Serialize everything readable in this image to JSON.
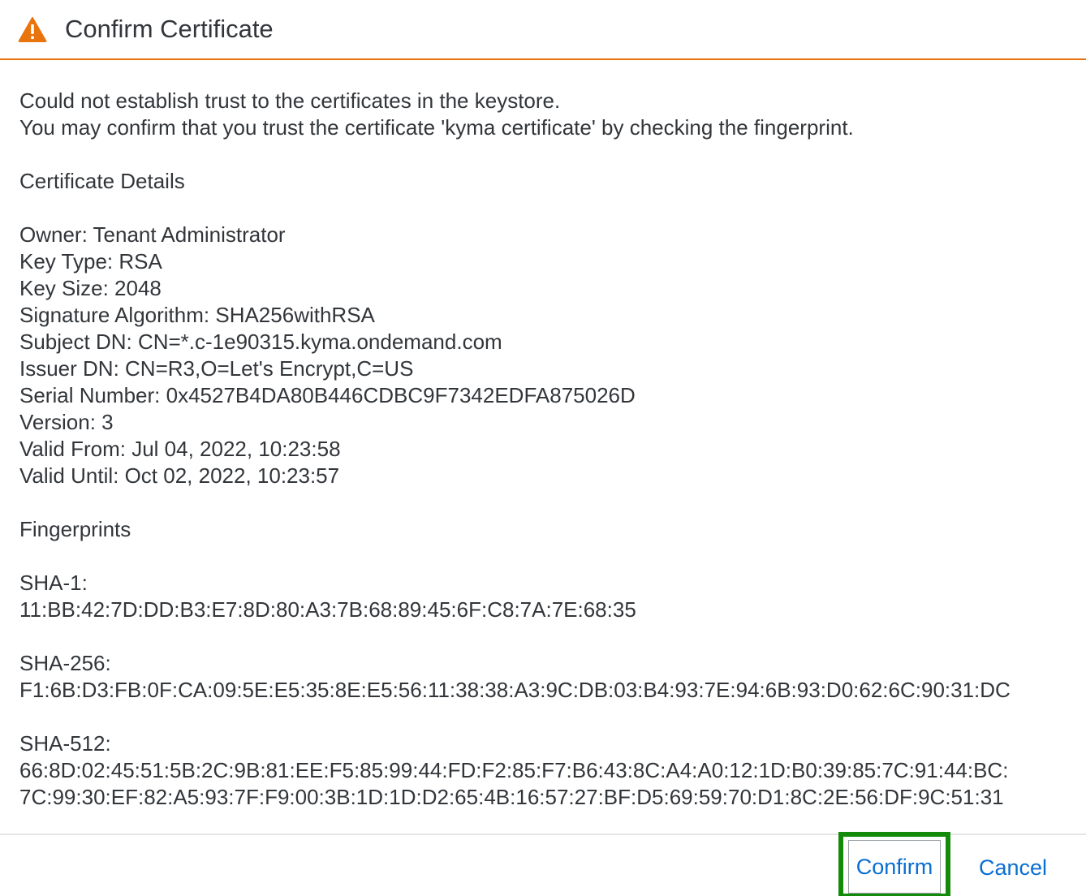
{
  "dialog": {
    "title": "Confirm Certificate",
    "icon": "warning-icon",
    "accent_color": "#e9730c"
  },
  "message": {
    "line1": "Could not establish trust to the certificates in the keystore.",
    "line2": "You may confirm that you trust the certificate 'kyma certificate' by checking the fingerprint."
  },
  "details": {
    "heading": "Certificate Details",
    "owner": "Owner: Tenant Administrator",
    "key_type": "Key Type: RSA",
    "key_size": "Key Size: 2048",
    "signature_algorithm": "Signature Algorithm: SHA256withRSA",
    "subject_dn": "Subject DN: CN=*.c-1e90315.kyma.ondemand.com",
    "issuer_dn": "Issuer DN: CN=R3,O=Let's Encrypt,C=US",
    "serial_number": "Serial Number: 0x4527B4DA80B446CDBC9F7342EDFA875026D",
    "version": "Version: 3",
    "valid_from": "Valid From: Jul 04, 2022, 10:23:58",
    "valid_until": "Valid Until: Oct 02, 2022, 10:23:57"
  },
  "fingerprints": {
    "heading": "Fingerprints",
    "sha1_label": "SHA-1:",
    "sha1_value": "11:BB:42:7D:DD:B3:E7:8D:80:A3:7B:68:89:45:6F:C8:7A:7E:68:35",
    "sha256_label": "SHA-256:",
    "sha256_value": "F1:6B:D3:FB:0F:CA:09:5E:E5:35:8E:E5:56:11:38:38:A3:9C:DB:03:B4:93:7E:94:6B:93:D0:62:6C:90:31:DC",
    "sha512_label": "SHA-512:",
    "sha512_value_line1": "66:8D:02:45:51:5B:2C:9B:81:EE:F5:85:99:44:FD:F2:85:F7:B6:43:8C:A4:A0:12:1D:B0:39:85:7C:91:44:BC:",
    "sha512_value_line2": "7C:99:30:EF:82:A5:93:7F:F9:00:3B:1D:1D:D2:65:4B:16:57:27:BF:D5:69:59:70:D1:8C:2E:56:DF:9C:51:31"
  },
  "footer": {
    "confirm_label": "Confirm",
    "cancel_label": "Cancel",
    "link_color": "#0a6ed1",
    "highlight_color": "#138a09"
  }
}
